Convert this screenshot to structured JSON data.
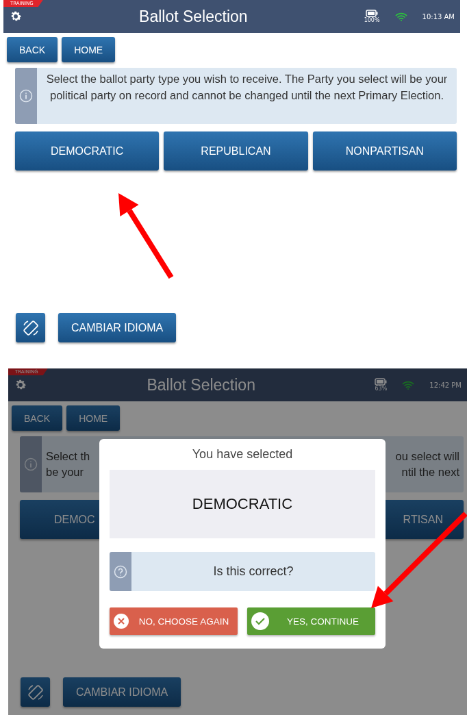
{
  "screens": [
    {
      "kind": "main",
      "training_label": "TRAINING",
      "title": "Ballot Selection",
      "battery": "100%",
      "time": "10:13 AM",
      "nav_buttons": [
        "BACK",
        "HOME"
      ],
      "info": {
        "text": "Select the ballot party type you wish to receive. The Party you select will be your political party on record and cannot be changed until the next Primary Election."
      },
      "party_buttons": [
        "DEMOCRATIC",
        "REPUBLICAN",
        "NONPARTISAN"
      ],
      "language_button": "CAMBIAR IDIOMA"
    },
    {
      "kind": "dialog",
      "training_label": "TRAINING",
      "title": "Ballot Selection",
      "battery": "63%",
      "time": "12:42 PM",
      "nav_buttons": [
        "BACK",
        "HOME"
      ],
      "info": {
        "left_lines": [
          "Select th",
          "be your"
        ],
        "right_lines": [
          "ou select will",
          "ntil the next"
        ]
      },
      "party_left": "DEMOC",
      "party_right": "RTISAN",
      "language_button": "CAMBIAR IDIOMA",
      "dialog": {
        "heading": "You have selected",
        "selection": "DEMOCRATIC",
        "question": "Is this correct?",
        "cancel_button": "NO, CHOOSE AGAIN",
        "confirm_button": "YES, CONTINUE"
      }
    }
  ]
}
